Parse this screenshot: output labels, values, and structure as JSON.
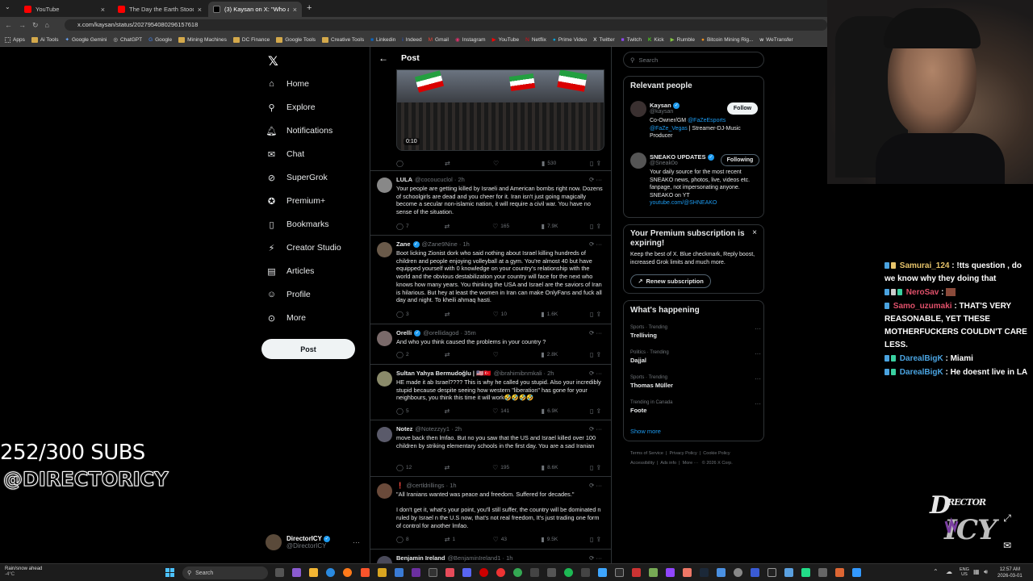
{
  "browser": {
    "tabs": [
      {
        "title": "YouTube",
        "favicon_color": "#ff0000",
        "active": false
      },
      {
        "title": "The Day the Earth Stood Still (2",
        "favicon_color": "#ff0000",
        "active": false
      },
      {
        "title": "(3) Kaysan on X: \"Who are you",
        "favicon_color": "#000000",
        "active": true
      }
    ],
    "url": "x.com/kaysan/status/2027954080296157618",
    "bookmarks": [
      "Apps",
      "Ai Tools",
      "Google Gemini",
      "ChatGPT",
      "Google",
      "Mining Machines",
      "DC Finance",
      "Google Tools",
      "Creative Tools",
      "Linkedin",
      "Indeed",
      "Gmail",
      "Instagram",
      "YouTube",
      "Netflix",
      "Prime Video",
      "Twitter",
      "Twitch",
      "Kick",
      "Rumble",
      "Bitcoin Mining Rig...",
      "WeTransfer"
    ]
  },
  "nav": {
    "items": [
      "Home",
      "Explore",
      "Notifications",
      "Chat",
      "SuperGrok",
      "Premium+",
      "Bookmarks",
      "Creator Studio",
      "Articles",
      "Profile",
      "More"
    ],
    "icons": [
      "home-icon",
      "search-icon",
      "bell-icon",
      "mail-icon",
      "grok-icon",
      "premium-icon",
      "bookmark-icon",
      "creator-icon",
      "article-icon",
      "profile-icon",
      "more-icon"
    ],
    "post_label": "Post",
    "account_name": "DirectorICY",
    "account_handle": "@DirectorICY"
  },
  "post": {
    "header": "Post",
    "video_time": "0:10",
    "views": "530"
  },
  "replies": [
    {
      "name": "LULA",
      "handle": "@cocoucuclol · 2h",
      "text": "Your people are getting killed by Israeli and American bombs right now. Dozens of schoolgirls are dead and you cheer for it. Iran isn't just going magically become a secular non-islamic nation, it will require a civil war. You have no sense of the situation.",
      "replies": "7",
      "likes": "165",
      "views": "7.9K",
      "avatar_color": "#888888"
    },
    {
      "name": "Zane",
      "handle": "@Zane9Nine · 1h",
      "text": "Boot licking Zionist dork who said nothing about Israel killing hundreds of children and people enjoying volleyball at a gym. You're almost 40 but have equipped yourself with 0 knowledge on your country's relationship with the world and the obvious destabilization your country will face for the next who knows how many years. You thinking the USA and Israel are the saviors of Iran is hilarious. But hey at least the women in Iran can make OnlyFans and fuck all day and night. To kheili ahmaq hasti.",
      "replies": "3",
      "likes": "10",
      "views": "1.6K",
      "avatar_color": "#6a5a4a"
    },
    {
      "name": "Orelli",
      "handle": "@orellidagod · 35m",
      "text": "And who you think caused the problems in your country ?",
      "replies": "2",
      "likes": "",
      "views": "2.8K",
      "avatar_color": "#7a6a6a"
    },
    {
      "name": "Sultan Yahya Bermudoğlu | 🇺🇸🇹🇷",
      "handle": "@ibrahimibnmkali · 2h",
      "text": "HE made it ab Israel???? This is why he called you stupid. Also your incredibly stupid because despite seeing how western \"liberation\" has gone for your neighbours, you think this time it will work🤣🤣🤣🤣",
      "replies": "5",
      "likes": "141",
      "views": "6.9K",
      "avatar_color": "#8a8a6a"
    },
    {
      "name": "Notez",
      "handle": "@Notezzyy1 · 2h",
      "text": "move back then lmfao. But no you saw that the US and Israel killed over 100 children by striking elementary schools in the first day. You are a sad Iranian",
      "replies": "12",
      "likes": "195",
      "views": "8.6K",
      "avatar_color": "#5a5a6a"
    },
    {
      "name": "❗",
      "handle": "@certldrillings · 1h",
      "text": "\"All Iranians wanted was peace and freedom. Suffered for decades.\"\n\nI don't get it, what's your point, you'll still suffer, the country will be dominated n ruled by Israel n the U.S now, that's not real freedom, It's just trading one form of control for another lmfao.",
      "replies": "8",
      "reposts": "1",
      "likes": "43",
      "views": "9.5K",
      "avatar_color": "#6a4a3a"
    },
    {
      "name": "Benjamin Ireland",
      "handle": "@BenjaminIreland1 · 1h",
      "text": "",
      "replies": "",
      "likes": "",
      "views": "",
      "avatar_color": "#4a4a5a"
    }
  ],
  "right": {
    "search_placeholder": "Search",
    "relevant_title": "Relevant people",
    "people": [
      {
        "name": "Kaysan",
        "handle": "@kaysan",
        "button": "Follow",
        "bio_pre": "Co-Owner/GM ",
        "bio_link1": "@FaZeEsports",
        "bio_link2": "@FaZe_Vegas",
        "bio_post": " | Streamer-DJ-Music Producer"
      },
      {
        "name": "SNEAKO UPDATES",
        "handle": "@Sneak0o",
        "button": "Following",
        "bio_pre": "Your daily source for the most recent SNEAKO news, photos, live, videos etc. fanpage, not impersonating anyone. SNEAKO on YT ",
        "bio_link1": "youtube.com/@SHNEAKO",
        "bio_link2": "",
        "bio_post": ""
      }
    ],
    "premium": {
      "title": "Your Premium subscription is expiring!",
      "body": "Keep the best of X. Blue checkmark, Reply boost, increased Grok limits and much more.",
      "button": "Renew subscription"
    },
    "happening": {
      "title": "What's happening",
      "items": [
        {
          "meta": "Sports · Trending",
          "topic": "Trelliving"
        },
        {
          "meta": "Politics · Trending",
          "topic": "Dajjal"
        },
        {
          "meta": "Sports · Trending",
          "topic": "Thomas Müller"
        },
        {
          "meta": "Trending in Canada",
          "topic": "Foote"
        }
      ],
      "show_more": "Show more"
    },
    "footer": [
      "Terms of Service",
      "Privacy Policy",
      "Cookie Policy",
      "Accessibility",
      "Ads info",
      "More ···",
      "© 2026 X Corp."
    ]
  },
  "overlay": {
    "subs": "252/300 SUBS",
    "handle": "@DIRECTORICY",
    "logo_text": "DirectorICY",
    "chat": [
      {
        "user": "Samurai_124",
        "user_color": "#e6c36a",
        "msg": "!tts question , do we know why they doing that"
      },
      {
        "user": "NeroSav",
        "user_color": "#e0506a",
        "msg": ""
      },
      {
        "user": "Samo_uzumaki",
        "user_color": "#e0506a",
        "msg": "THAT'S VERY REASONABLE, YET THESE MOTHERFUCKERS COULDN'T CARE LESS."
      },
      {
        "user": "DarealBigK",
        "user_color": "#4aa3e0",
        "msg": "Miami"
      },
      {
        "user": "DarealBigK",
        "user_color": "#4aa3e0",
        "msg": "He doesnt live in LA"
      }
    ]
  },
  "taskbar": {
    "weather_title": "Rain/snow ahead",
    "weather_temp": "-4°C",
    "search": "Search",
    "lang1": "ENG",
    "lang2": "US",
    "time": "12:57 AM",
    "date": "2026-03-01"
  },
  "colors": {
    "accent": "#1d9bf0",
    "background": "#000000",
    "text": "#e7e9ea",
    "muted": "#71767b"
  }
}
